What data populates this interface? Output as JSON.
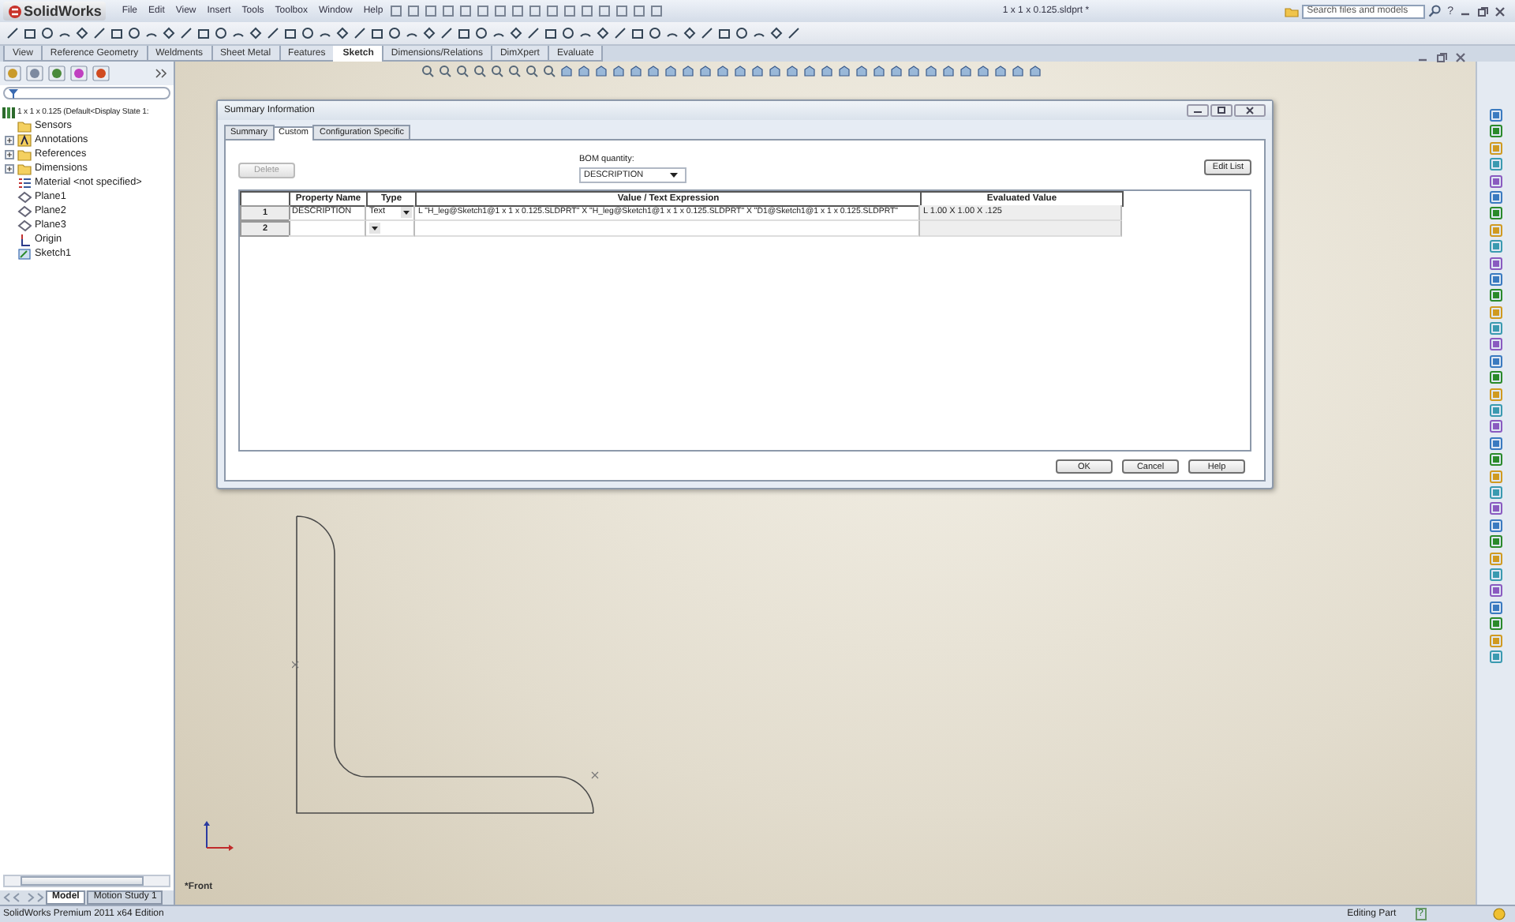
{
  "app": {
    "logo": "SolidWorks",
    "menu": [
      "File",
      "Edit",
      "View",
      "Insert",
      "Tools",
      "Toolbox",
      "Window",
      "Help"
    ],
    "document_title": "1 x 1 x 0.125.sldprt *",
    "search": {
      "placeholder": "Search files and models"
    },
    "help": "?"
  },
  "command_tabs": [
    {
      "label": "View",
      "selected": false
    },
    {
      "label": "Reference Geometry",
      "selected": false
    },
    {
      "label": "Weldments",
      "selected": false
    },
    {
      "label": "Sheet Metal",
      "selected": false
    },
    {
      "label": "Features",
      "selected": false
    },
    {
      "label": "Sketch",
      "selected": true
    },
    {
      "label": "Dimensions/Relations",
      "selected": false
    },
    {
      "label": "DimXpert",
      "selected": false
    },
    {
      "label": "Evaluate",
      "selected": false
    }
  ],
  "feature_tree": {
    "root": "1 x 1 x 0.125  (Default<Display State 1:",
    "items": [
      {
        "label": "Sensors",
        "kind": "folder",
        "collapsed": false
      },
      {
        "label": "Annotations",
        "kind": "annotation",
        "collapsed": true
      },
      {
        "label": "References",
        "kind": "folder",
        "collapsed": true
      },
      {
        "label": "Dimensions",
        "kind": "folder",
        "collapsed": true
      },
      {
        "label": "Material <not specified>",
        "kind": "material",
        "collapsed": false
      },
      {
        "label": "Plane1",
        "kind": "plane",
        "collapsed": false
      },
      {
        "label": "Plane2",
        "kind": "plane",
        "collapsed": false
      },
      {
        "label": "Plane3",
        "kind": "plane",
        "collapsed": false
      },
      {
        "label": "Origin",
        "kind": "origin",
        "collapsed": false
      },
      {
        "label": "Sketch1",
        "kind": "sketch",
        "collapsed": false
      }
    ]
  },
  "dialog": {
    "title": "Summary Information",
    "tabs": [
      {
        "label": "Summary",
        "selected": false
      },
      {
        "label": "Custom",
        "selected": true
      },
      {
        "label": "Configuration Specific",
        "selected": false
      }
    ],
    "delete_button": {
      "label": "Delete",
      "disabled": true
    },
    "bom_label": "BOM quantity:",
    "bom_value": "DESCRIPTION",
    "edit_list": "Edit List",
    "columns": [
      "Property Name",
      "Type",
      "Value / Text Expression",
      "Evaluated Value"
    ],
    "rows": [
      {
        "number": "1",
        "name": "DESCRIPTION",
        "type": "Text",
        "value": "L \"H_leg@Sketch1@1 x 1 x 0.125.SLDPRT\" X \"H_leg@Sketch1@1 x 1 x 0.125.SLDPRT\" X \"D1@Sketch1@1 x 1 x 0.125.SLDPRT\"",
        "evaluated": "L 1.00 X 1.00 X .125"
      },
      {
        "number": "2"
      }
    ],
    "buttons": [
      "OK",
      "Cancel",
      "Help"
    ]
  },
  "viewport": {
    "view_label": "*Front"
  },
  "bottom_tabs": [
    {
      "label": "Model",
      "selected": true
    },
    {
      "label": "Motion Study 1",
      "selected": false
    }
  ],
  "status_bar": {
    "edition": "SolidWorks Premium 2011 x64 Edition",
    "mode": "Editing Part",
    "help": "?"
  }
}
